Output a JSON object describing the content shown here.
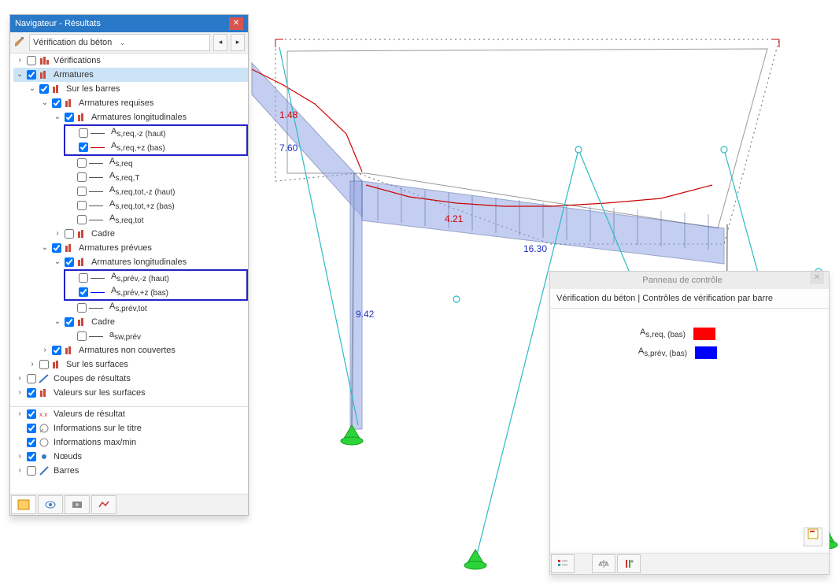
{
  "navigator": {
    "title": "Navigateur - Résultats",
    "dropdown_label": "Vérification du béton",
    "tree1": {
      "verifications": "Vérifications",
      "armatures": "Armatures",
      "sur_les_barres": "Sur les barres",
      "arm_requises": "Armatures requises",
      "arm_long": "Armatures longitudinales",
      "a_req_mz": "A",
      "a_req_mz_sub": "s,req,-z (haut)",
      "a_req_pz": "A",
      "a_req_pz_sub": "s,req,+z (bas)",
      "a_req": "A",
      "a_req_sub": "s,req",
      "a_reqT": "A",
      "a_reqT_sub": "s,req,T",
      "a_reqtot_mz": "A",
      "a_reqtot_mz_sub": "s,req,tot,-z (haut)",
      "a_reqtot_pz": "A",
      "a_reqtot_pz_sub": "s,req,tot,+z (bas)",
      "a_reqtot": "A",
      "a_reqtot_sub": "s,req,tot",
      "cadre": "Cadre",
      "arm_prevues": "Armatures prévues",
      "a_prev_mz": "A",
      "a_prev_mz_sub": "s,prév,-z (haut)",
      "a_prev_pz": "A",
      "a_prev_pz_sub": "s,prév,+z (bas)",
      "a_prev_tot": "A",
      "a_prev_tot_sub": "s,prév,tot",
      "asw_prev": "a",
      "asw_prev_sub": "sw,prév",
      "arm_non_couvertes": "Armatures non couvertes",
      "sur_les_surfaces": "Sur les surfaces",
      "coupes": "Coupes de résultats",
      "valeurs_surfaces": "Valeurs sur les surfaces"
    },
    "tree2": {
      "valeurs_res": "Valeurs de résultat",
      "infos_titre": "Informations sur le titre",
      "infos_maxmin": "Informations max/min",
      "noeuds": "Nœuds",
      "barres": "Barres"
    }
  },
  "structure": {
    "v148": "1.48",
    "v760": "7.60",
    "v421": "4.21",
    "v1630": "16.30",
    "v942": "9.42"
  },
  "control_panel": {
    "title": "Panneau de contrôle",
    "subtitle": "Vérification du béton | Contrôles de vérification par barre",
    "leg1main": "A",
    "leg1sub": "s,req, (bas)",
    "leg2main": "A",
    "leg2sub": "s,prév, (bas)"
  },
  "chart_data": {
    "type": "3d-structural-diagram",
    "annotated_values": [
      {
        "label": "1.48",
        "color": "red"
      },
      {
        "label": "7.60",
        "color": "blue"
      },
      {
        "label": "4.21",
        "color": "red"
      },
      {
        "label": "16.30",
        "color": "blue"
      },
      {
        "label": "9.42",
        "color": "blue"
      }
    ],
    "legend": [
      {
        "name": "A s,req, (bas)",
        "color": "#ff0000"
      },
      {
        "name": "A s,prév, (bas)",
        "color": "#0000ff"
      }
    ]
  }
}
